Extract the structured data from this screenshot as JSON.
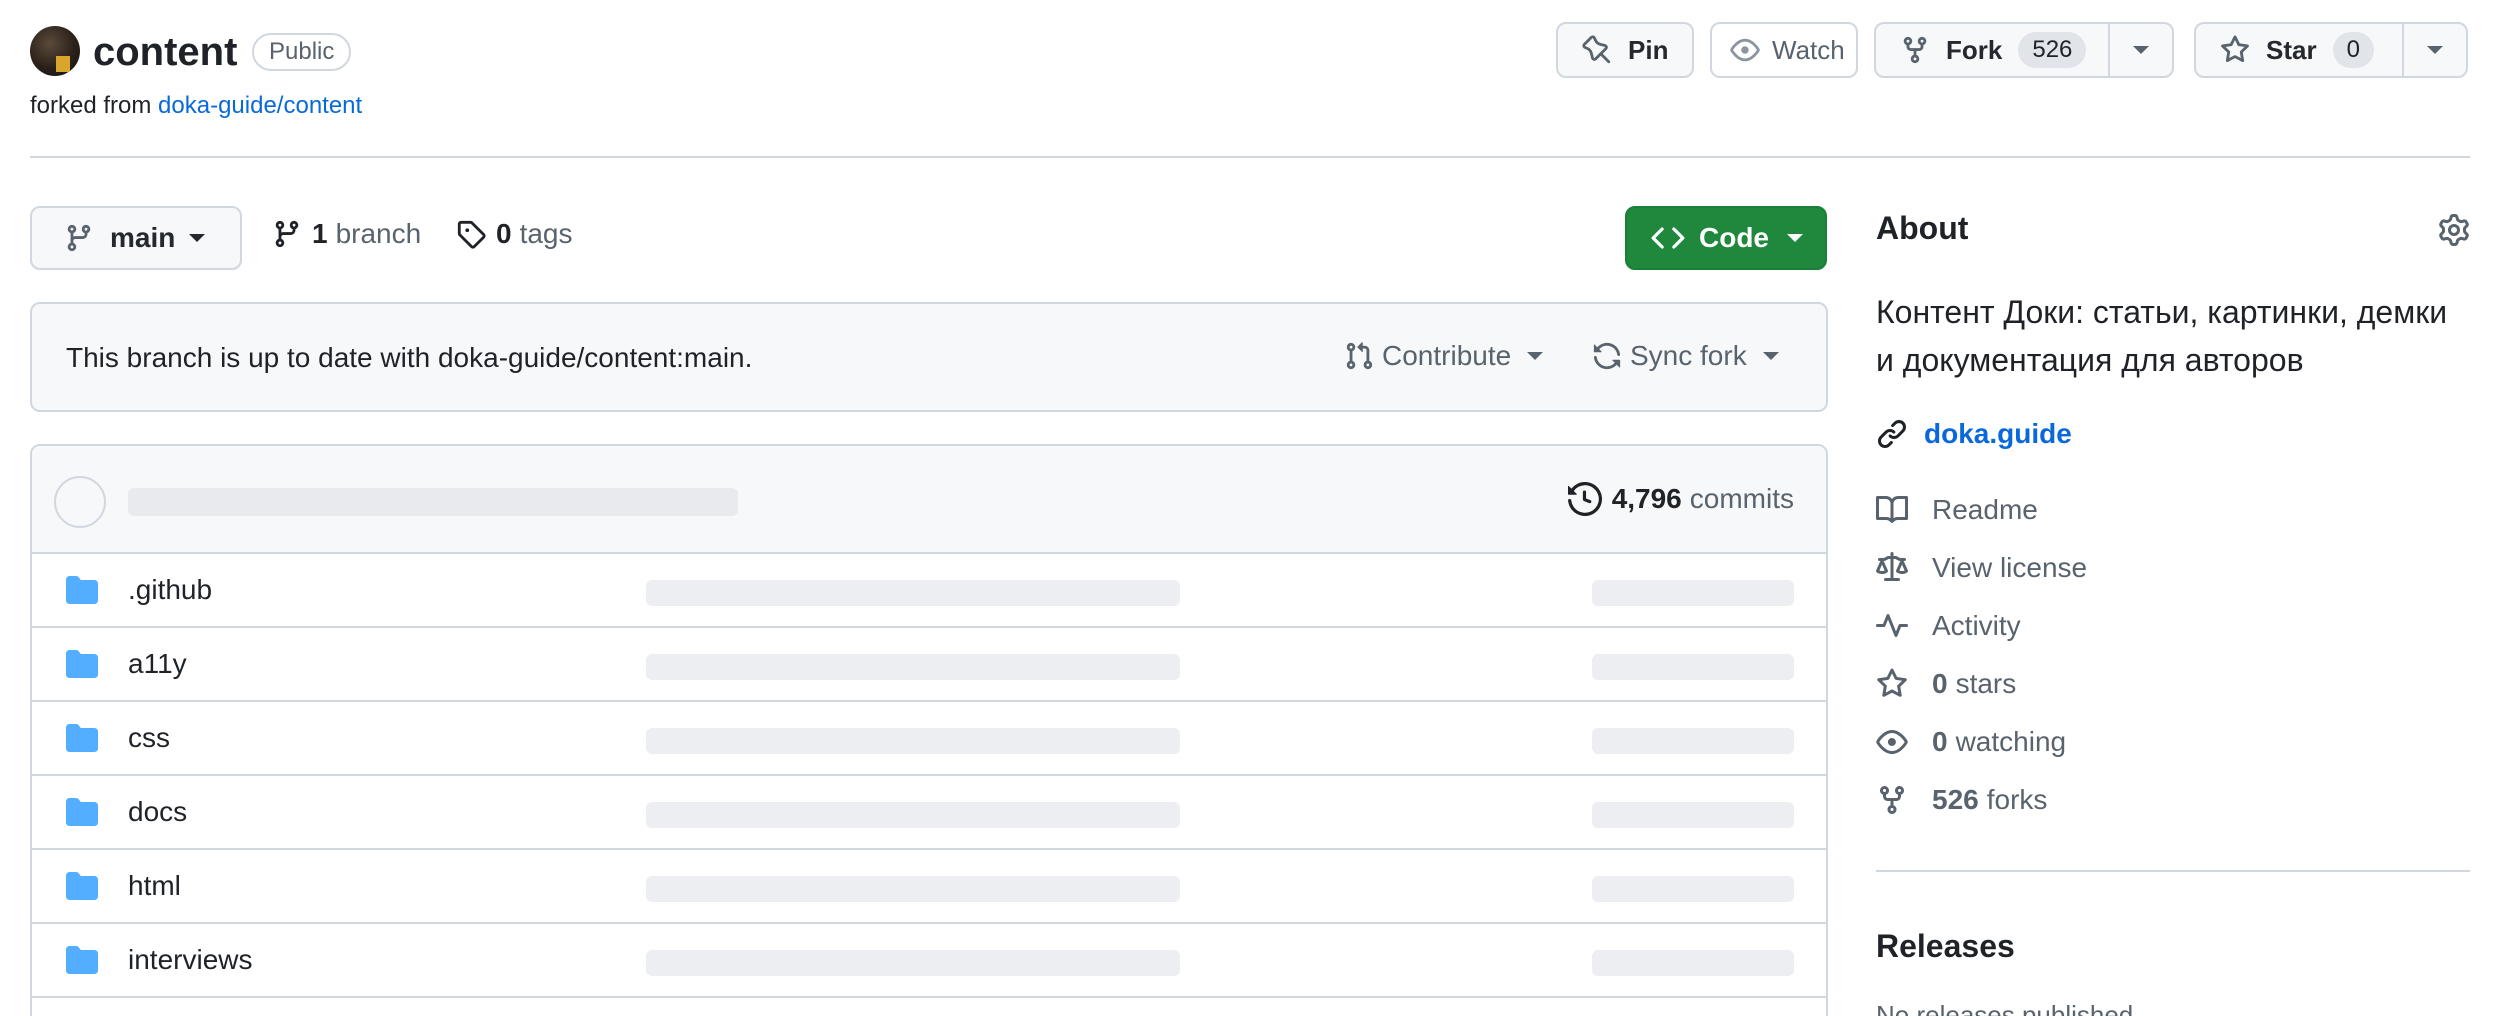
{
  "repo": {
    "name": "content",
    "visibility": "Public",
    "forked_prefix": "forked from",
    "forked_source": "doka-guide/content"
  },
  "header_actions": {
    "pin_label": "Pin",
    "watch_label": "Watch",
    "fork_label": "Fork",
    "fork_count": "526",
    "star_label": "Star",
    "star_count": "0"
  },
  "branch_bar": {
    "current_branch": "main",
    "branch_count": "1",
    "branch_label": "branch",
    "tag_count": "0",
    "tag_label": "tags",
    "code_label": "Code"
  },
  "banner": {
    "text": "This branch is up to date with doka-guide/content:main.",
    "contribute_label": "Contribute",
    "sync_label": "Sync fork"
  },
  "files": {
    "commit_count": "4,796",
    "commit_label": "commits",
    "rows": [
      {
        "name": ".github"
      },
      {
        "name": "a11y"
      },
      {
        "name": "css"
      },
      {
        "name": "docs"
      },
      {
        "name": "html"
      },
      {
        "name": "interviews"
      }
    ]
  },
  "about": {
    "title": "About",
    "description": "Контент Доки: статьи, картинки, демки и документация для авторов",
    "homepage": "doka.guide",
    "readme": "Readme",
    "license": "View license",
    "activity": "Activity",
    "stars_count": "0",
    "stars_label": "stars",
    "watching_count": "0",
    "watching_label": "watching",
    "forks_count": "526",
    "forks_label": "forks"
  },
  "releases": {
    "title": "Releases",
    "subtitle": "No releases published"
  },
  "colors": {
    "link": "#0969da",
    "primary_button": "#1f883d",
    "folder": "#54aeff",
    "border": "#d0d7de"
  }
}
